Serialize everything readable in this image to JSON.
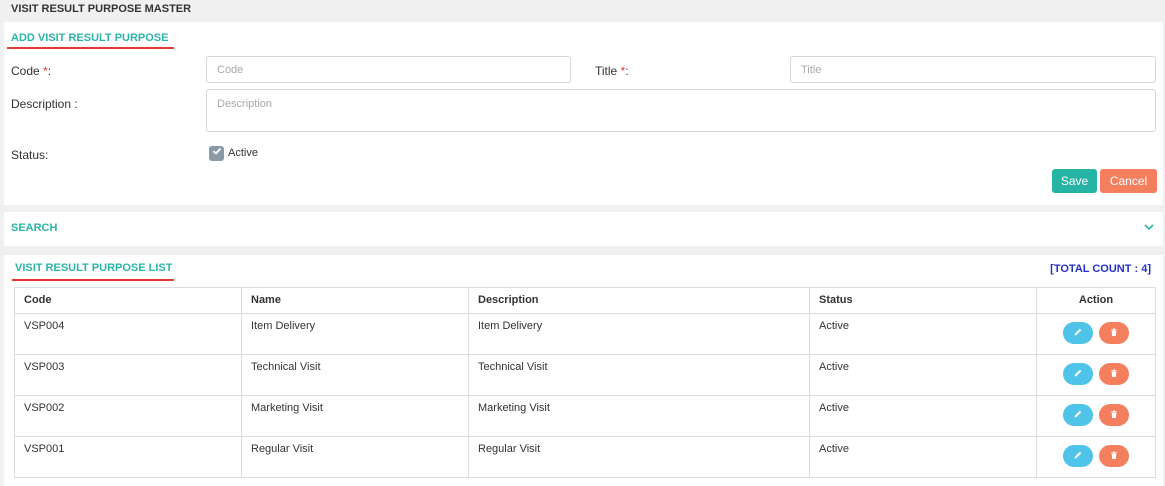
{
  "page": {
    "title": "VISIT RESULT PURPOSE MASTER"
  },
  "add_form": {
    "heading": "ADD VISIT RESULT PURPOSE",
    "code_label": "Code ",
    "code_placeholder": "Code",
    "title_label": "Title ",
    "title_placeholder": "Title",
    "required_mark": "*",
    "label_colon": ":",
    "description_label": "Description :",
    "description_placeholder": "Description",
    "status_label": "Status:",
    "status_checkbox_label": "Active",
    "status_checked": true,
    "save_label": "Save",
    "cancel_label": "Cancel"
  },
  "search": {
    "heading": "SEARCH"
  },
  "list": {
    "heading": "VISIT RESULT PURPOSE LIST",
    "total_count": "[TOTAL COUNT : 4]",
    "columns": [
      "Code",
      "Name",
      "Description",
      "Status",
      "Action"
    ],
    "rows": [
      {
        "code": "VSP004",
        "name": "Item Delivery",
        "description": "Item Delivery",
        "status": "Active"
      },
      {
        "code": "VSP003",
        "name": "Technical Visit",
        "description": "Technical Visit",
        "status": "Active"
      },
      {
        "code": "VSP002",
        "name": "Marketing Visit",
        "description": "Marketing Visit",
        "status": "Active"
      },
      {
        "code": "VSP001",
        "name": "Regular Visit",
        "description": "Regular Visit",
        "status": "Active"
      }
    ]
  },
  "colors": {
    "accent": "#2bb5a8",
    "underline": "#e53935",
    "save": "#26b5a5",
    "cancel": "#f47f5f",
    "edit": "#4fc3e8",
    "count": "#2530c8"
  },
  "icons": {
    "edit": "pencil-icon",
    "delete": "trash-icon",
    "toggle": "chevron-down-icon",
    "checkbox": "checkmark-icon"
  }
}
